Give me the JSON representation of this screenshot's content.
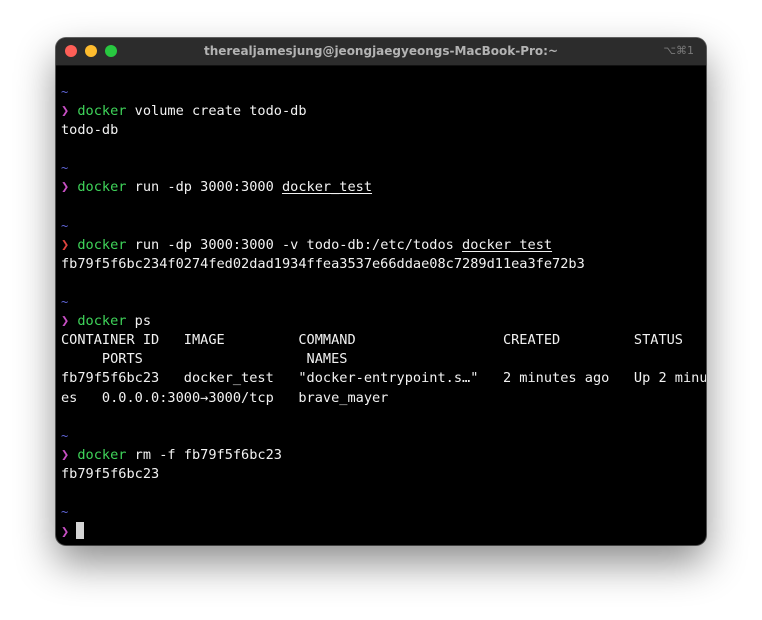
{
  "window": {
    "title": "therealjamesjung@jeongjaegyeongs-MacBook-Pro:~",
    "shortcut": "⌥⌘1"
  },
  "terminal": {
    "tilde": "~",
    "prompt_symbol": "❯",
    "blocks": [
      {
        "command": "docker",
        "args": " volume create todo-db",
        "output": [
          "todo-db"
        ]
      },
      {
        "command": "docker",
        "args": " run -dp 3000:3000 ",
        "image": "docker_test"
      },
      {
        "command": "docker",
        "args": " run -dp 3000:3000 -v todo-db:/etc/todos ",
        "image": "docker_test",
        "output": [
          "fb79f5f6bc234f0274fed02dad1934ffea3537e66ddae08c7289d11ea3fe72b3"
        ]
      },
      {
        "command": "docker",
        "args": " ps",
        "output": [
          "CONTAINER ID   IMAGE         COMMAND                  CREATED         STATUS",
          "     PORTS                    NAMES",
          "fb79f5f6bc23   docker_test   \"docker-entrypoint.s…\"   2 minutes ago   Up 2 minut",
          "es   0.0.0.0:3000→3000/tcp   brave_mayer"
        ]
      },
      {
        "command": "docker",
        "args": " rm -f fb79f5f6bc23",
        "output": [
          "fb79f5f6bc23"
        ]
      }
    ]
  },
  "colors": {
    "background": "#000000",
    "command": "#3fd45a",
    "prompt": "#c84fc4",
    "prompt_error": "#e2443f",
    "tilde": "#5f64d6"
  }
}
